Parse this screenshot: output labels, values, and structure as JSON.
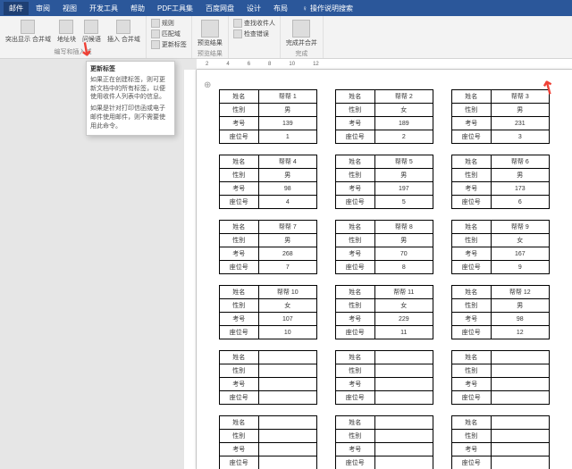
{
  "menus": [
    "邮件",
    "审阅",
    "视图",
    "开发工具",
    "帮助",
    "PDF工具集",
    "百度网盘",
    "设计",
    "布局"
  ],
  "search": "操作说明搜索",
  "ribbon": {
    "g1": {
      "items": [
        "突出显示 合并域",
        "地址块",
        "问候语",
        "插入 合并域"
      ],
      "label": "编写和插入域",
      "small": [
        "规则",
        "匹配域",
        "更新标签"
      ]
    },
    "g2": {
      "items": [
        "预览结果"
      ],
      "label": "预览结果",
      "small": [
        "查找收件人",
        "检查错误"
      ]
    },
    "g3": {
      "items": [
        "完成并合并"
      ],
      "label": "完成"
    }
  },
  "tooltip": {
    "title": "更新标签",
    "l1": "如果正在创建标签，则可更新文档中的所有标签，以便使用收件人列表中的信息。",
    "l2": "如果是针对打印信函或电子邮件使用邮件，则不需要使用此命令。"
  },
  "ruler": [
    "2",
    "4",
    "6",
    "8",
    "10",
    "12"
  ],
  "fields": {
    "name": "姓名",
    "gender": "性别",
    "id": "考号",
    "seat": "座位号"
  },
  "cards": [
    [
      {
        "n": "帮帮 1",
        "g": "男",
        "i": "139",
        "s": "1"
      },
      {
        "n": "帮帮 2",
        "g": "女",
        "i": "189",
        "s": "2"
      },
      {
        "n": "帮帮 3",
        "g": "男",
        "i": "231",
        "s": "3"
      }
    ],
    [
      {
        "n": "帮帮 4",
        "g": "男",
        "i": "98",
        "s": "4"
      },
      {
        "n": "帮帮 5",
        "g": "男",
        "i": "197",
        "s": "5"
      },
      {
        "n": "帮帮 6",
        "g": "男",
        "i": "173",
        "s": "6"
      }
    ],
    [
      {
        "n": "帮帮 7",
        "g": "男",
        "i": "268",
        "s": "7"
      },
      {
        "n": "帮帮 8",
        "g": "男",
        "i": "70",
        "s": "8"
      },
      {
        "n": "帮帮 9",
        "g": "女",
        "i": "167",
        "s": "9"
      }
    ],
    [
      {
        "n": "帮帮 10",
        "g": "女",
        "i": "107",
        "s": "10"
      },
      {
        "n": "帮帮 11",
        "g": "女",
        "i": "229",
        "s": "11"
      },
      {
        "n": "帮帮 12",
        "g": "男",
        "i": "98",
        "s": "12"
      }
    ],
    [
      {
        "n": "",
        "g": "",
        "i": "",
        "s": ""
      },
      {
        "n": "",
        "g": "",
        "i": "",
        "s": ""
      },
      {
        "n": "",
        "g": "",
        "i": "",
        "s": ""
      }
    ],
    [
      {
        "n": "",
        "g": "",
        "i": "",
        "s": ""
      },
      {
        "n": "",
        "g": "",
        "i": "",
        "s": ""
      },
      {
        "n": "",
        "g": "",
        "i": "",
        "s": ""
      }
    ]
  ]
}
